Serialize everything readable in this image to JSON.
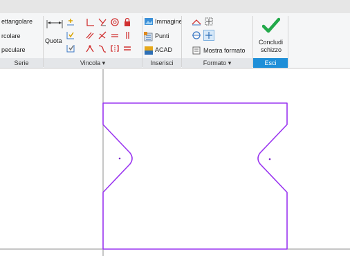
{
  "series_panel": {
    "items": [
      "ettangolare",
      "rcolare",
      "peculare"
    ],
    "caption": "Serie"
  },
  "constrain_panel": {
    "dimension_label": "Quota",
    "caption": "Vincola ▾"
  },
  "insert_panel": {
    "items": [
      "Immagine",
      "Punti",
      "ACAD"
    ],
    "caption": "Inserisci"
  },
  "format_panel": {
    "show_format_label": "Mostra formato",
    "caption": "Formato ▾"
  },
  "exit_panel": {
    "finish_label_line1": "Concludi",
    "finish_label_line2": "schizzo",
    "caption": "Esci"
  },
  "colors": {
    "sketch_profile": "#9a35f0",
    "axis_lines": "#8c8c8c",
    "check_green": "#22a94a",
    "exit_blue": "#1f8fd8"
  }
}
